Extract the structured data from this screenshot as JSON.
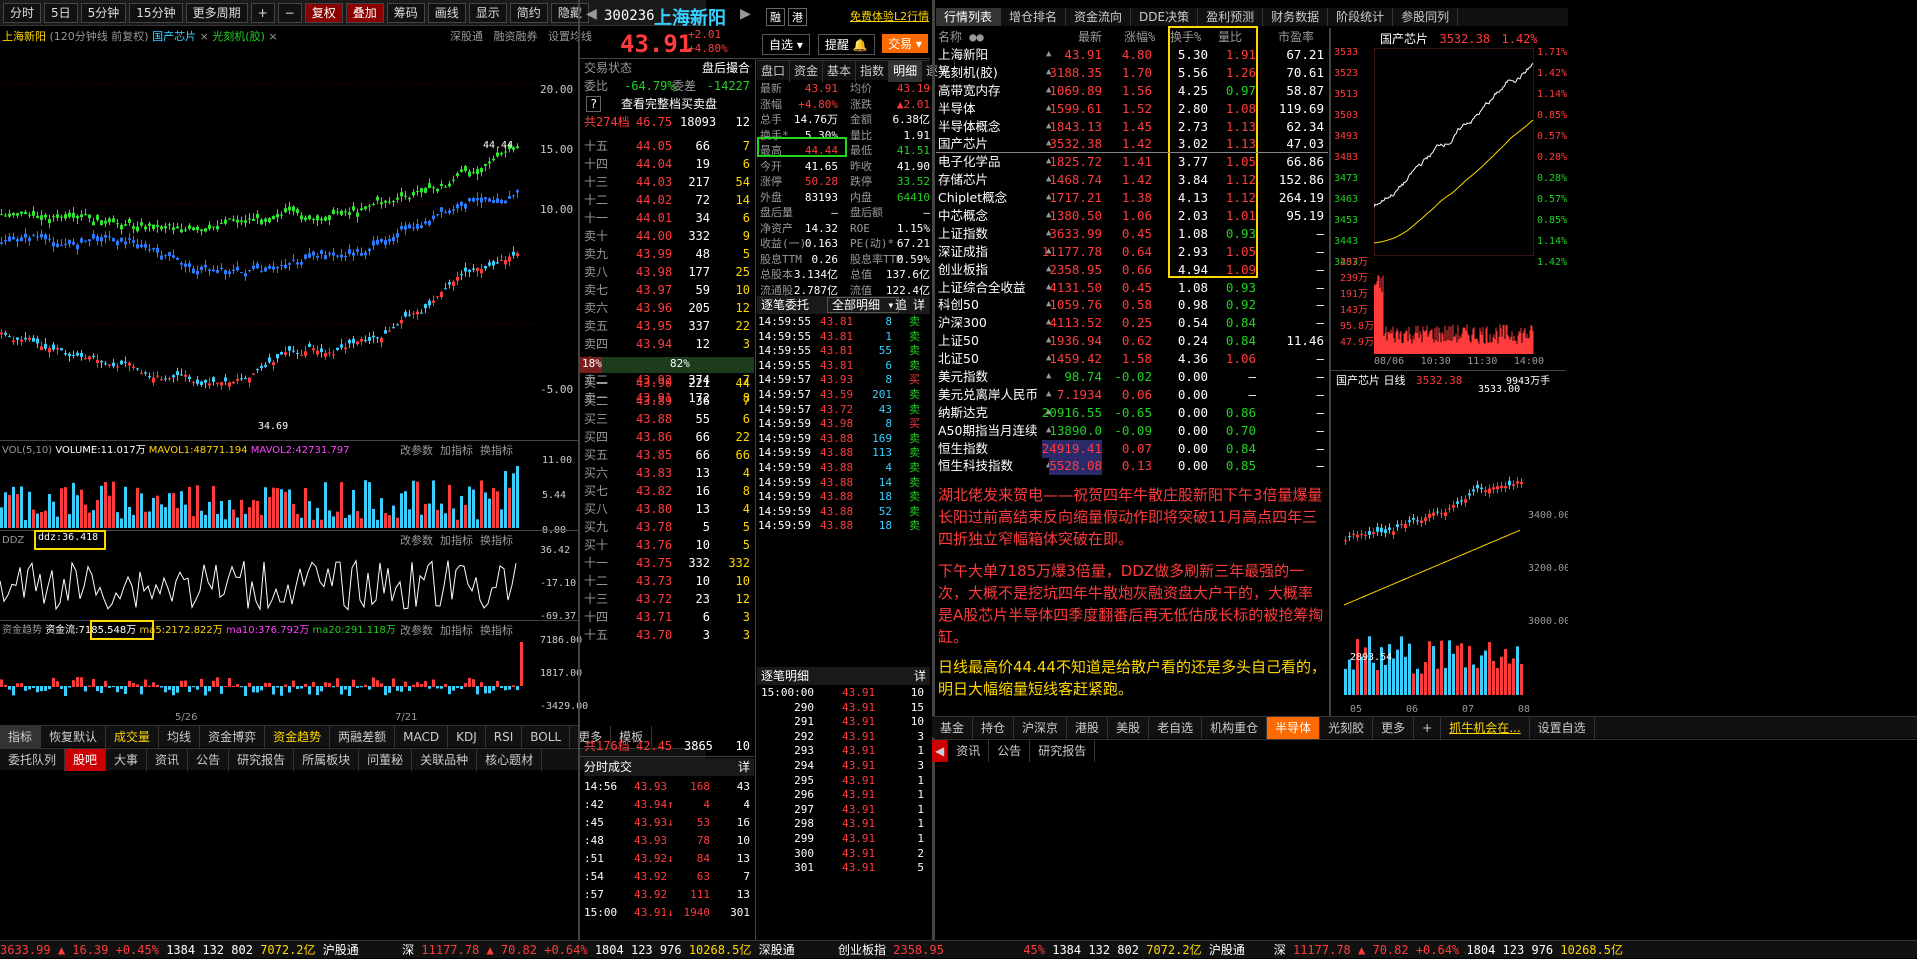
{
  "toolbar": {
    "items": [
      "分时",
      "5日",
      "5分钟",
      "15分钟",
      "更多周期",
      "+",
      "−",
      "复权",
      "叠加",
      "筹码",
      "画线",
      "显示",
      "简约",
      "隐藏"
    ]
  },
  "chart": {
    "name": "上海新阳",
    "info": "(120分钟线 前复权)",
    "overlay1": "国产芯片",
    "overlay2": "光刻机(胶)",
    "links": [
      "深股通",
      "融资融券",
      "设置均线"
    ],
    "yticks": [
      "20.00",
      "15.00",
      "10.00",
      "5.00",
      "-5.00"
    ],
    "hi_label": "44.44",
    "lo_label": "34.69",
    "x1": "5/26",
    "x2": "7/21"
  },
  "vol": {
    "hd": "VOL(5,10)",
    "volume": "VOLUME:11.017万",
    "mavol1": "MAVOL1:48771.194",
    "mavol2": "MAVOL2:42731.797",
    "btns": [
      "改参数",
      "加指标",
      "换指标"
    ],
    "ticks": [
      "11.00",
      "5.44",
      "0.00"
    ]
  },
  "ddz": {
    "hd": "DDZ",
    "val": "ddz:36.418",
    "btns": [
      "改参数",
      "加指标",
      "换指标"
    ],
    "ticks": [
      "36.42",
      "-17.10",
      "-69.37"
    ]
  },
  "fund": {
    "hd": "资金趋势",
    "val": "资金流:7185.548万",
    "ma5": "ma5:2172.822万",
    "ma10": "ma10:376.792万",
    "ma20": "ma20:291.118万",
    "btns": [
      "改参数",
      "加指标",
      "换指标"
    ],
    "ticks": [
      "7186.00",
      "1817.00",
      "-3429.00"
    ]
  },
  "ind_tabs": [
    "指标",
    "恢复默认",
    "成交量",
    "均线",
    "资金博弈",
    "资金趋势",
    "两融差额",
    "MACD",
    "KDJ",
    "RSI",
    "BOLL",
    "更多"
  ],
  "ind_right": "模板",
  "bottom_tabs": [
    "委托队列",
    "股吧",
    "大事",
    "资讯",
    "公告",
    "研究报告",
    "所属板块",
    "问董秘",
    "关联品种",
    "核心题材"
  ],
  "status": {
    "sh": "3633.99",
    "shchg": "▲ 16.39 +0.45%",
    "n1": "1384",
    "n2": "132",
    "n3": "802",
    "amt": "7072.2亿",
    "hgt": "沪股通",
    "sz_label": "深",
    "sz": "11177.78",
    "szchg": "▲ 70.82 +0.64%",
    "n4": "1804",
    "n5": "123",
    "n6": "976",
    "amt2": "10268.5亿",
    "sgt": "深股通",
    "cyb_label": "创业板指",
    "cyb": "2358.95",
    "r_pct": "45%",
    "r_n1": "1384",
    "r_n2": "132",
    "r_n3": "802",
    "r_amt": "7072.2亿",
    "r_hgt": "沪股通",
    "r_sz": "深",
    "r_szv": "11177.78",
    "r_szchg": "▲ 70.82 +0.64%",
    "r_n4": "1804",
    "r_n5": "123",
    "r_n6": "976",
    "r_amt2": "10268.5亿"
  },
  "quote": {
    "code": "300236",
    "name": "上海新阳",
    "tag1": "融",
    "tag2": "港",
    "l2": "免费体验L2行情",
    "price": "43.91",
    "chg": "+2.01",
    "pct": "+4.80%",
    "zx": "自选",
    "tx": "提醒",
    "jy": "交易",
    "jyzt": "交易状态",
    "phph": "盘后撮合",
    "wb": "委比",
    "wb_v": "-64.79%",
    "wc": "委差",
    "wc_v": "-14227",
    "full": "查看完整档买卖盘",
    "sell_total": "共274档",
    "sell_total_p": "46.75",
    "sell_total_v": "18093",
    "sell_total_n": "12",
    "sells": [
      [
        "十五",
        "44.05",
        "66",
        "7"
      ],
      [
        "十四",
        "44.04",
        "19",
        "6"
      ],
      [
        "十三",
        "44.03",
        "217",
        "54"
      ],
      [
        "十二",
        "44.02",
        "72",
        "14"
      ],
      [
        "十一",
        "44.01",
        "34",
        "6"
      ],
      [
        "卖十",
        "44.00",
        "332",
        "9"
      ],
      [
        "卖九",
        "43.99",
        "48",
        "5"
      ],
      [
        "卖八",
        "43.98",
        "177",
        "25"
      ],
      [
        "卖七",
        "43.97",
        "59",
        "10"
      ],
      [
        "卖六",
        "43.96",
        "205",
        "12"
      ],
      [
        "卖五",
        "43.95",
        "337",
        "22"
      ],
      [
        "卖四",
        "43.94",
        "12",
        "3"
      ],
      [
        "卖三",
        "43.93",
        "2",
        "2"
      ],
      [
        "卖二",
        "43.92",
        "374",
        "7"
      ],
      [
        "卖一",
        "43.91",
        "172",
        "8"
      ]
    ],
    "ratio_l": "18%",
    "ratio_m": "82%",
    "buys": [
      [
        "买一",
        "43.90",
        "221",
        "44"
      ],
      [
        "买二",
        "43.89",
        "36",
        "7"
      ],
      [
        "买三",
        "43.88",
        "55",
        "6"
      ],
      [
        "买四",
        "43.86",
        "66",
        "22"
      ],
      [
        "买五",
        "43.85",
        "66",
        "66"
      ],
      [
        "买六",
        "43.83",
        "13",
        "4"
      ],
      [
        "买七",
        "43.82",
        "16",
        "8"
      ],
      [
        "买八",
        "43.80",
        "13",
        "4"
      ],
      [
        "买九",
        "43.78",
        "5",
        "5"
      ],
      [
        "买十",
        "43.76",
        "10",
        "5"
      ],
      [
        "十一",
        "43.75",
        "332",
        "332"
      ],
      [
        "十二",
        "43.73",
        "10",
        "10"
      ],
      [
        "十三",
        "43.72",
        "23",
        "12"
      ],
      [
        "十四",
        "43.71",
        "6",
        "3"
      ],
      [
        "十五",
        "43.70",
        "3",
        "3"
      ]
    ],
    "buy_total": "共176档",
    "buy_total_p": "42.45",
    "buy_total_v": "3865",
    "buy_total_n": "10"
  },
  "pk_tabs": [
    "盘口",
    "资金",
    "基本",
    "指数",
    "明细",
    "逐笔"
  ],
  "pk": [
    [
      "最新",
      "43.91",
      "均价",
      "43.19"
    ],
    [
      "涨幅",
      "+4.80%",
      "涨跌",
      "▲2.01"
    ],
    [
      "总手",
      "14.76万",
      "金额",
      "6.38亿"
    ],
    [
      "换手*",
      "5.30%",
      "量比",
      "1.91"
    ],
    [
      "最高",
      "44.44",
      "最低",
      "41.51"
    ],
    [
      "今开",
      "41.65",
      "昨收",
      "41.90"
    ],
    [
      "涨停",
      "50.28",
      "跌停",
      "33.52"
    ],
    [
      "外盘",
      "83193",
      "内盘",
      "64410"
    ],
    [
      "盘后量",
      "—",
      "盘后额",
      "—"
    ],
    [
      "净资产",
      "14.32",
      "ROE",
      "1.15%"
    ],
    [
      "收益(一)",
      "0.163",
      "PE(动)*",
      "67.21"
    ],
    [
      "股息TTM",
      "0.26",
      "股息率TTM",
      "0.59%"
    ],
    [
      "总股本",
      "3.134亿",
      "总值",
      "137.6亿"
    ],
    [
      "流通股",
      "2.787亿",
      "流值",
      "122.4亿"
    ]
  ],
  "zbwt": {
    "hd": "逐笔委托",
    "filter": "全部明细",
    "btn1": "追",
    "btn2": "详",
    "rows": [
      [
        "14:59:55",
        "43.81",
        "8",
        "卖"
      ],
      [
        "14:59:55",
        "43.81",
        "1",
        "卖"
      ],
      [
        "14:59:55",
        "43.81",
        "55",
        "卖"
      ],
      [
        "14:59:55",
        "43.81",
        "6",
        "卖"
      ],
      [
        "14:59:57",
        "43.93",
        "8",
        "买"
      ],
      [
        "14:59:57",
        "43.59",
        "201",
        "卖"
      ],
      [
        "14:59:57",
        "43.72",
        "43",
        "卖"
      ],
      [
        "14:59:59",
        "43.98",
        "8",
        "买"
      ],
      [
        "14:59:59",
        "43.88",
        "169",
        "卖"
      ],
      [
        "14:59:59",
        "43.88",
        "113",
        "卖"
      ],
      [
        "14:59:59",
        "43.88",
        "4",
        "卖"
      ],
      [
        "14:59:59",
        "43.88",
        "14",
        "卖"
      ],
      [
        "14:59:59",
        "43.88",
        "18",
        "卖"
      ],
      [
        "14:59:59",
        "43.88",
        "52",
        "卖"
      ],
      [
        "14:59:59",
        "43.88",
        "18",
        "卖"
      ]
    ]
  },
  "fscj": {
    "hd": "分时成交",
    "btn": "详",
    "rows": [
      [
        "14:56",
        "43.93",
        "168",
        "43"
      ],
      [
        ":42",
        "43.94↑",
        "4",
        "4"
      ],
      [
        ":45",
        "43.93↓",
        "53",
        "16"
      ],
      [
        ":48",
        "43.93",
        "78",
        "10"
      ],
      [
        ":51",
        "43.92↓",
        "84",
        "13"
      ],
      [
        ":54",
        "43.92",
        "63",
        "7"
      ],
      [
        ":57",
        "43.92",
        "111",
        "13"
      ],
      [
        "15:00",
        "43.91↓",
        "1940",
        "301"
      ]
    ]
  },
  "zbmx": {
    "hd": "逐笔明细",
    "btn": "详",
    "rows": [
      [
        "15:00:00",
        "43.91",
        "10"
      ],
      [
        "290",
        "43.91",
        "15"
      ],
      [
        "291",
        "43.91",
        "10"
      ],
      [
        "292",
        "43.91",
        "3"
      ],
      [
        "293",
        "43.91",
        "1"
      ],
      [
        "294",
        "43.91",
        "3"
      ],
      [
        "295",
        "43.91",
        "1"
      ],
      [
        "296",
        "43.91",
        "1"
      ],
      [
        "297",
        "43.91",
        "1"
      ],
      [
        "298",
        "43.91",
        "1"
      ],
      [
        "299",
        "43.91",
        "1"
      ],
      [
        "300",
        "43.91",
        "2"
      ],
      [
        "301",
        "43.91",
        "5"
      ]
    ]
  },
  "rank_tabs": [
    "行情列表",
    "增仓排名",
    "资金流向",
    "DDE决策",
    "盈利预测",
    "财务数据",
    "阶段统计",
    "参股同列"
  ],
  "rank_cols": [
    "名称",
    "最新",
    "涨幅%",
    "换手%",
    "量比",
    "市盈率"
  ],
  "rank": [
    [
      "上海新阳",
      "43.91",
      "4.80",
      "5.30",
      "1.91",
      "67.21"
    ],
    [
      "光刻机(胶)",
      "3188.35",
      "1.70",
      "5.56",
      "1.26",
      "70.61"
    ],
    [
      "高带宽内存",
      "1069.89",
      "1.56",
      "4.25",
      "0.97",
      "58.87"
    ],
    [
      "半导体",
      "1599.61",
      "1.52",
      "2.80",
      "1.08",
      "119.69"
    ],
    [
      "半导体概念",
      "1843.13",
      "1.45",
      "2.73",
      "1.13",
      "62.34"
    ],
    [
      "国产芯片",
      "3532.38",
      "1.42",
      "3.02",
      "1.13",
      "47.03"
    ],
    [
      "电子化学品",
      "1825.72",
      "1.41",
      "3.77",
      "1.05",
      "66.86"
    ],
    [
      "存储芯片",
      "1468.74",
      "1.42",
      "3.84",
      "1.12",
      "152.86"
    ],
    [
      "Chiplet概念",
      "1717.21",
      "1.38",
      "4.13",
      "1.12",
      "264.19"
    ],
    [
      "中芯概念",
      "1380.50",
      "1.06",
      "2.03",
      "1.01",
      "95.19"
    ],
    [
      "上证指数",
      "3633.99",
      "0.45",
      "1.08",
      "0.93",
      "—"
    ],
    [
      "深证成指",
      "11177.78",
      "0.64",
      "2.93",
      "1.05",
      "—"
    ],
    [
      "创业板指",
      "2358.95",
      "0.66",
      "4.94",
      "1.09",
      "—"
    ],
    [
      "上证综合全收益",
      "4131.50",
      "0.45",
      "1.08",
      "0.93",
      "—"
    ],
    [
      "科创50",
      "1059.76",
      "0.58",
      "0.98",
      "0.92",
      "—"
    ],
    [
      "沪深300",
      "4113.52",
      "0.25",
      "0.54",
      "0.84",
      "—"
    ],
    [
      "上证50",
      "1936.94",
      "0.62",
      "0.24",
      "0.84",
      "11.46"
    ],
    [
      "北证50",
      "1459.42",
      "1.58",
      "4.36",
      "1.06",
      "—"
    ],
    [
      "美元指数",
      "98.74",
      "-0.02",
      "0.00",
      "—",
      "—"
    ],
    [
      "美元兑离岸人民币",
      "7.1934",
      "0.06",
      "0.00",
      "—",
      "—"
    ],
    [
      "纳斯达克",
      "20916.55",
      "-0.65",
      "0.00",
      "0.86",
      "—"
    ],
    [
      "A50期指当月连续",
      "13890.0",
      "-0.09",
      "0.00",
      "0.70",
      "—"
    ],
    [
      "恒生指数",
      "24919.41",
      "0.07",
      "0.00",
      "0.84",
      "—"
    ],
    [
      "恒生科技指数",
      "5528.08",
      "0.13",
      "0.00",
      "0.85",
      "—"
    ]
  ],
  "note": {
    "p1": "湖北佬发来贺电——祝贺四年牛散庄股新阳下午3倍量爆量长阳过前高结束反向缩量假动作即将突破11月高点四年三四折独立窄幅箱体突破在即。",
    "p2": "下午大单7185万爆3倍量，DDZ做多刷新三年最强的一次，大概不是挖坑四年牛散炮灰融资盘大户干的，大概率是A股芯片半导体四季度翻番后再无低估成长标的被抢筹掏缸。",
    "p3": "日线最高价44.44不知道是给散户看的还是多头自己看的，明日大幅缩量短线客赶紧跑。"
  },
  "sector_tabs": [
    "基金",
    "持仓",
    "沪深京",
    "港股",
    "美股",
    "老自选",
    "机构重仓",
    "半导体",
    "光刻胶",
    "更多",
    "+",
    "抓牛机会在...",
    "设置自选"
  ],
  "news_tabs": [
    "资讯",
    "公告",
    "研究报告"
  ],
  "mini1": {
    "name": "国产芯片",
    "price": "3532.38",
    "pct": "1.42%",
    "yl": [
      "3533",
      "3523",
      "3513",
      "3503",
      "3493",
      "3483",
      "3473",
      "3463",
      "3453",
      "3443",
      "3433"
    ],
    "yr": [
      "1.71%",
      "1.42%",
      "1.14%",
      "0.85%",
      "0.57%",
      "0.28%",
      "0.28%",
      "0.57%",
      "0.85%",
      "1.14%",
      "1.42%"
    ],
    "vl": [
      "287万",
      "239万",
      "191万",
      "143万",
      "95.8万",
      "47.9万"
    ],
    "xt": [
      "08/06",
      "10:30",
      "11:30",
      "14:00"
    ]
  },
  "mini2": {
    "name": "国产芯片",
    "type": "日线",
    "price": "3532.38",
    "vol": "9943万手",
    "hi": "3533.00",
    "lo": "2893.54",
    "yt": [
      "3400.00",
      "3200.00",
      "3000.00"
    ],
    "xt": [
      "05",
      "06",
      "07",
      "08"
    ]
  }
}
